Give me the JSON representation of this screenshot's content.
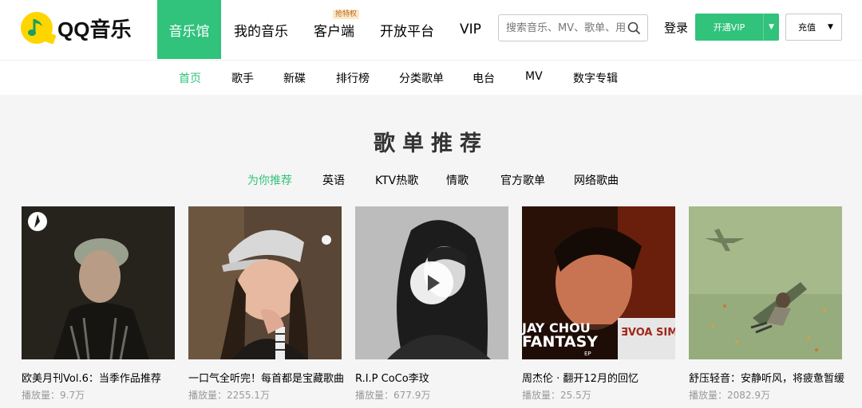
{
  "brand": {
    "name": "QQ音乐"
  },
  "nav": {
    "items": [
      {
        "label": "音乐馆"
      },
      {
        "label": "我的音乐"
      },
      {
        "label": "客户端",
        "badge": "抢特权"
      },
      {
        "label": "开放平台"
      },
      {
        "label": "VIP"
      }
    ]
  },
  "search": {
    "placeholder": "搜索音乐、MV、歌单、用户"
  },
  "account": {
    "login_label": "登录",
    "vip_label": "开通VIP",
    "charge_label": "充值"
  },
  "subnav": {
    "items": [
      "首页",
      "歌手",
      "新碟",
      "排行榜",
      "分类歌单",
      "电台",
      "MV",
      "数字专辑"
    ]
  },
  "section": {
    "title": "歌单推荐",
    "tabs": [
      "为你推荐",
      "英语",
      "KTV热歌",
      "情歌",
      "官方歌单",
      "网络歌曲"
    ]
  },
  "playlists": [
    {
      "title": "欧美月刊Vol.6：当季作品推荐",
      "plays": "播放量：9.7万"
    },
    {
      "title": "一口气全听完！每首都是宝藏歌曲",
      "plays": "播放量：2255.1万"
    },
    {
      "title": "R.I.P CoCo李玟",
      "plays": "播放量：677.9万"
    },
    {
      "title": "周杰伦 · 翻开12月的回忆",
      "plays": "播放量：25.5万"
    },
    {
      "title": "舒压轻音：安静听风，将疲惫暂缓",
      "plays": "播放量：2082.9万"
    }
  ],
  "album_art": {
    "line1": "JAY CHOU",
    "line2": "FANTASY",
    "line3": "EP",
    "back": "ƎVOA SIMPLE"
  },
  "colors": {
    "accent": "#31c27c",
    "logo_yellow": "#ffd500"
  }
}
